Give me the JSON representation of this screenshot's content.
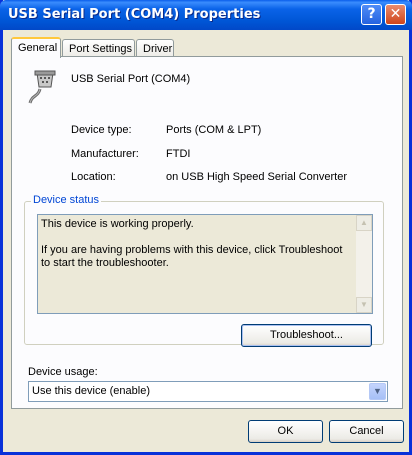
{
  "window": {
    "title": "USB Serial Port (COM4) Properties",
    "help_glyph": "?",
    "close_glyph": "✕",
    "accent": "#0a5eeb"
  },
  "tabs": [
    {
      "label": "General",
      "active": true
    },
    {
      "label": "Port Settings",
      "active": false
    },
    {
      "label": "Driver",
      "active": false
    }
  ],
  "general": {
    "device_name": "USB Serial Port (COM4)",
    "icon": "serial-port-icon",
    "properties": [
      {
        "label": "Device type:",
        "value": "Ports (COM & LPT)"
      },
      {
        "label": "Manufacturer:",
        "value": "FTDI"
      },
      {
        "label": "Location:",
        "value": "on USB High Speed Serial Converter"
      }
    ],
    "status_group_label": "Device status",
    "status_text": "This device is working properly.\n\nIf you are having problems with this device, click Troubleshoot to start the troubleshooter.",
    "troubleshoot_label": "Troubleshoot...",
    "usage_label": "Device usage:",
    "usage_value": "Use this device (enable)"
  },
  "footer": {
    "ok_label": "OK",
    "cancel_label": "Cancel"
  }
}
